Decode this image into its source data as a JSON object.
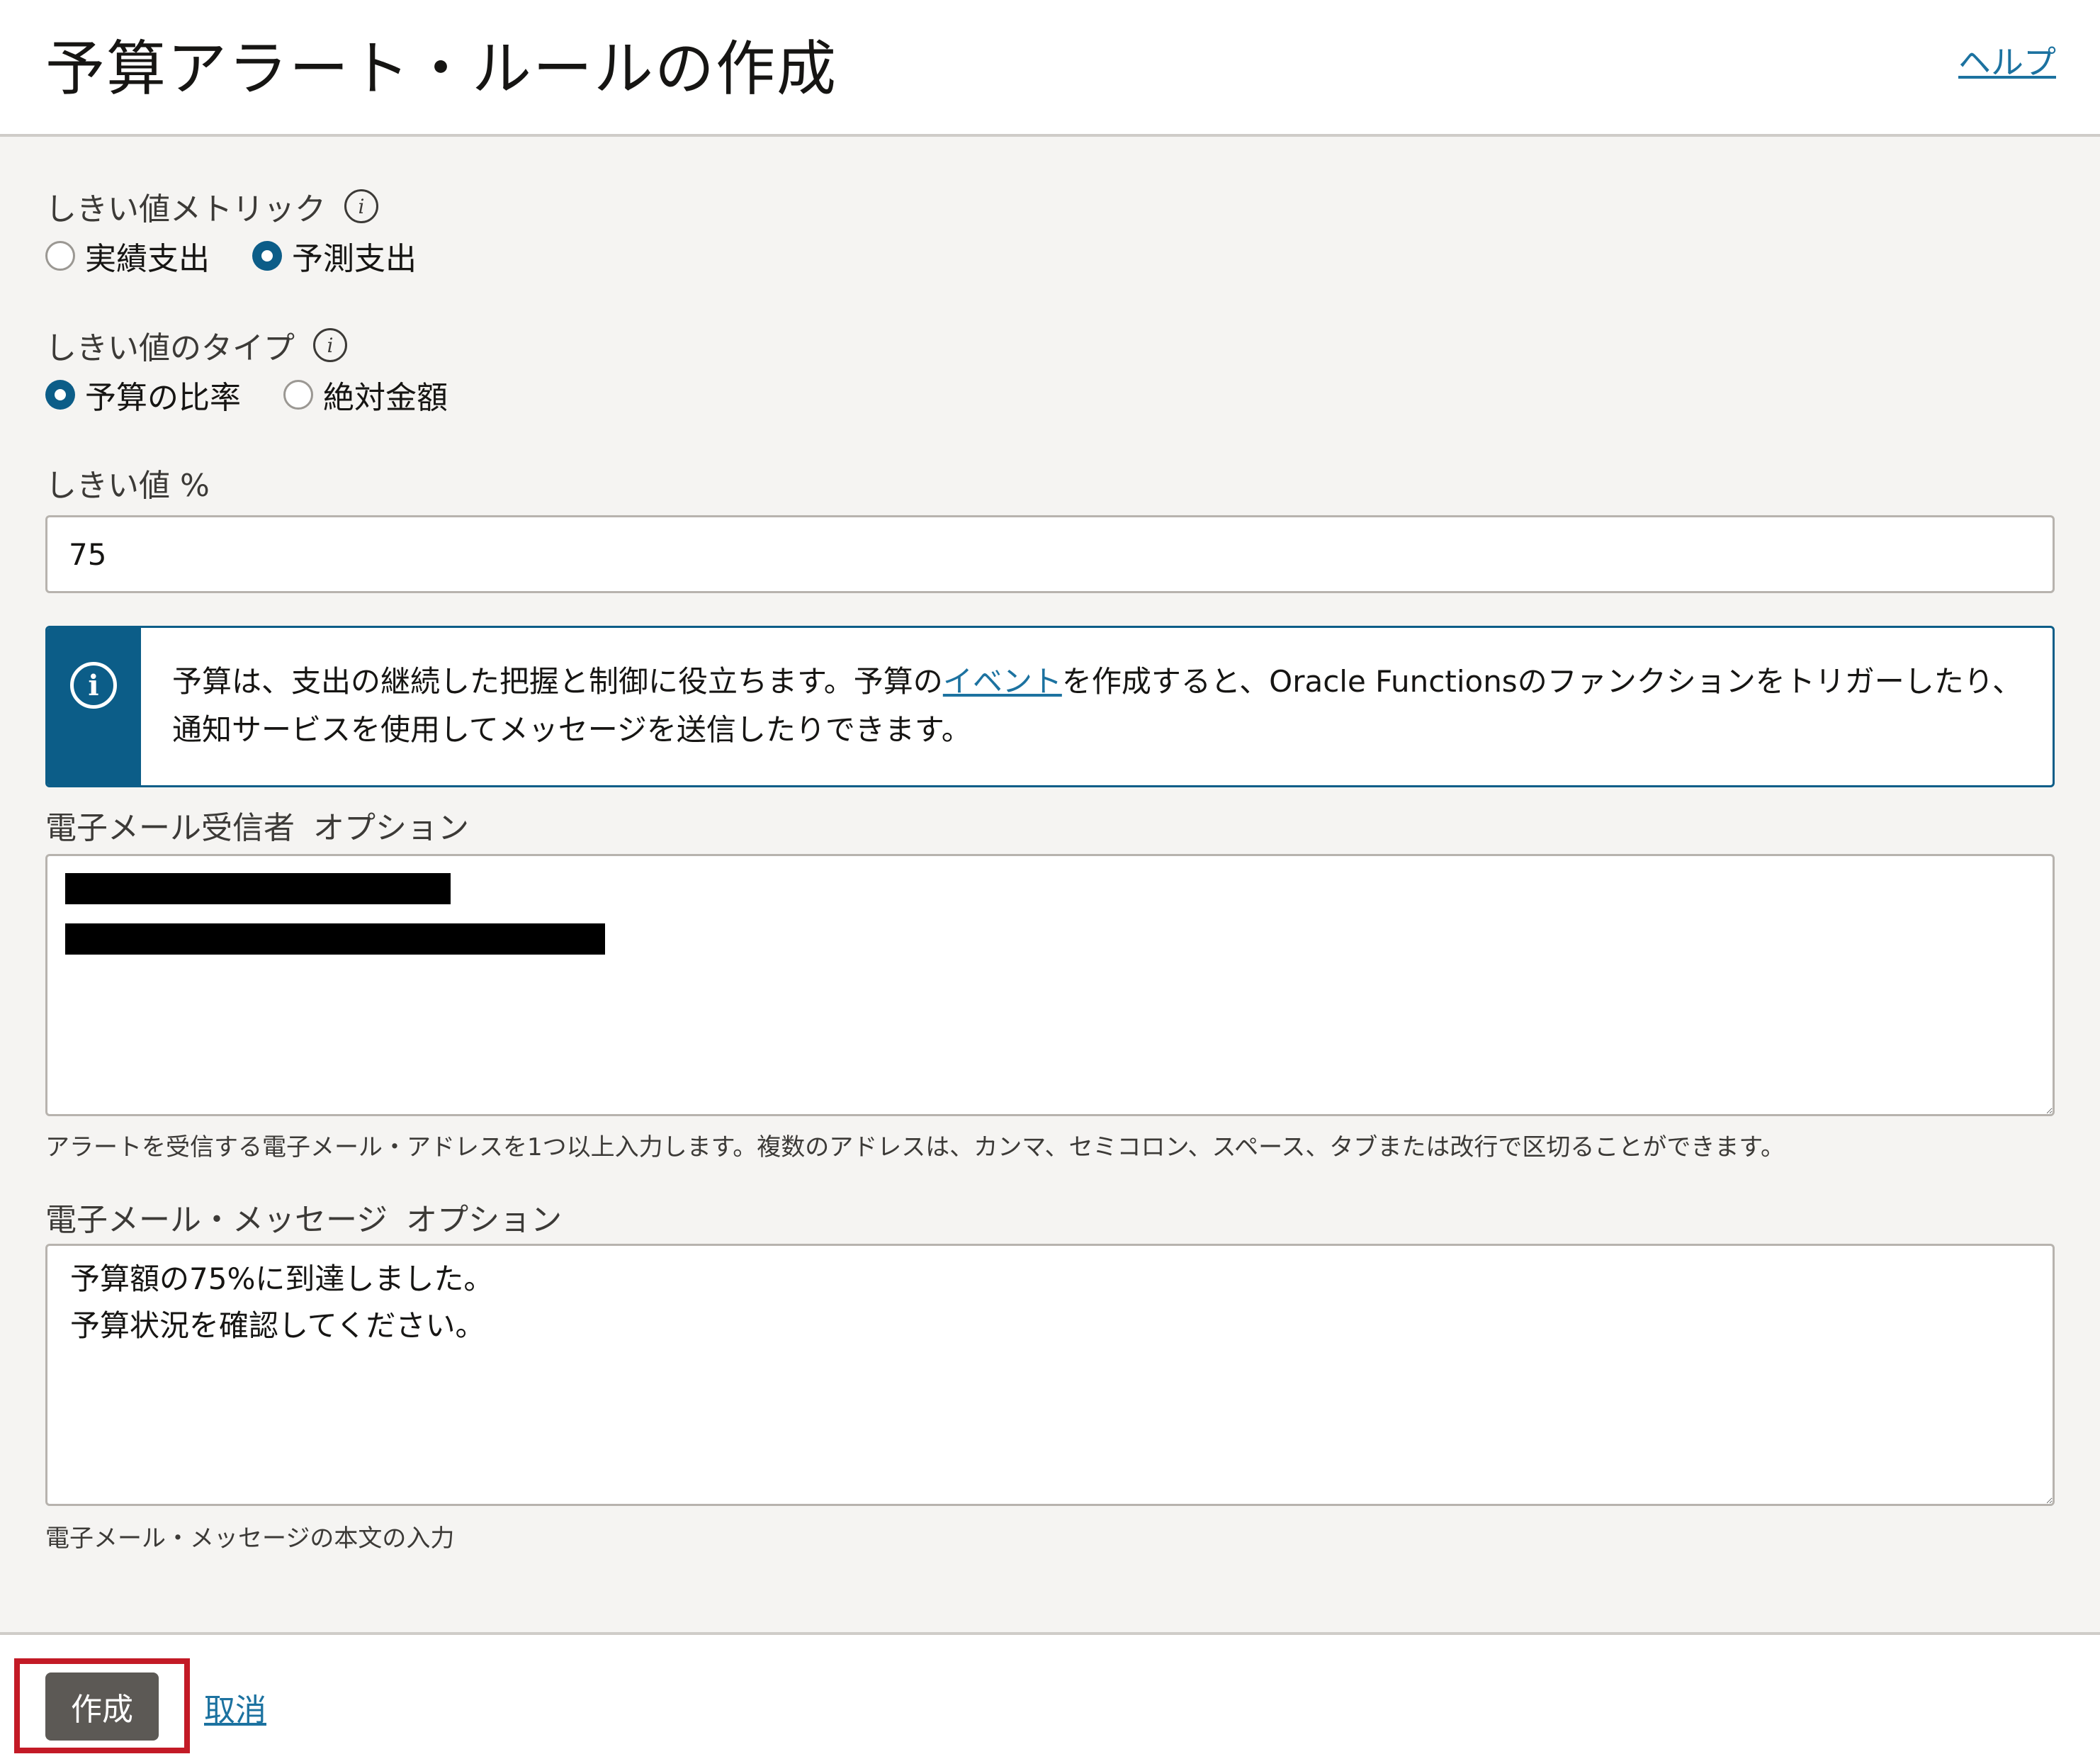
{
  "header": {
    "title": "予算アラート・ルールの作成",
    "help_label": "ヘルプ"
  },
  "threshold_metric": {
    "label": "しきい値メトリック",
    "options": [
      {
        "label": "実績支出",
        "selected": false
      },
      {
        "label": "予測支出",
        "selected": true
      }
    ]
  },
  "threshold_type": {
    "label": "しきい値のタイプ",
    "options": [
      {
        "label": "予算の比率",
        "selected": true
      },
      {
        "label": "絶対金額",
        "selected": false
      }
    ]
  },
  "threshold_value": {
    "label": "しきい値 %",
    "value": "75"
  },
  "info_banner": {
    "icon": "info-icon",
    "text_before": "予算は、支出の継続した把握と制御に役立ちます。予算の",
    "link_text": "イベント",
    "text_after": "を作成すると、Oracle Functionsのファンクションをトリガーしたり、通知サービスを使用してメッセージを送信したりできます。"
  },
  "email_recipients": {
    "label": "電子メール受信者",
    "optional": "オプション",
    "help": "アラートを受信する電子メール・アドレスを1つ以上入力します。複数のアドレスは、カンマ、セミコロン、スペース、タブまたは改行で区切ることができます。"
  },
  "email_message": {
    "label": "電子メール・メッセージ",
    "optional": "オプション",
    "value": "予算額の75%に到達しました。\n予算状況を確認してください。",
    "help": "電子メール・メッセージの本文の入力"
  },
  "footer": {
    "create_label": "作成",
    "cancel_label": "取消"
  },
  "colors": {
    "accent": "#0c5d88",
    "link": "#1c72a0",
    "highlight": "#c31a26",
    "primary_button": "#5c5955"
  }
}
